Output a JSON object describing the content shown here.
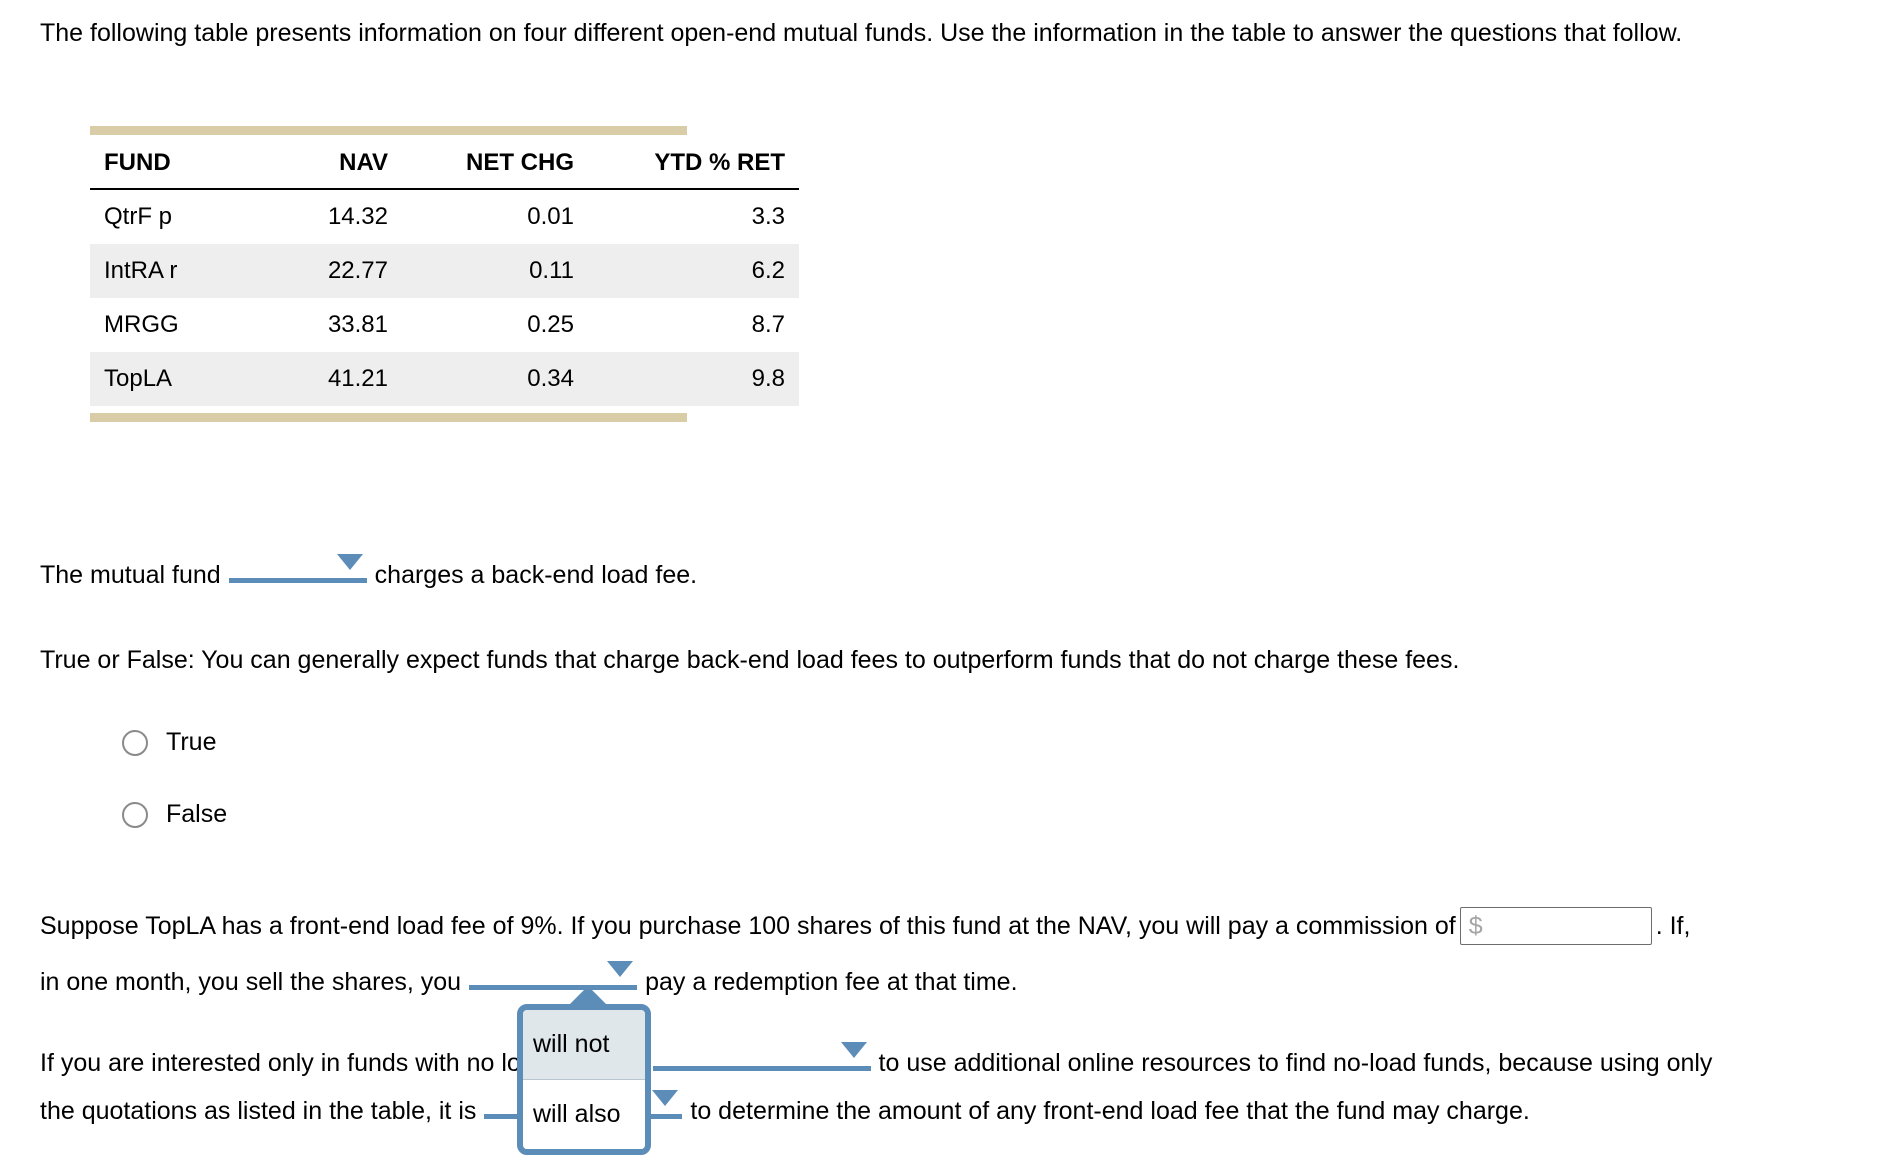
{
  "intro": "The following table presents information on four different open-end mutual funds. Use the information in the table to answer the questions that follow.",
  "table": {
    "headers": [
      "FUND",
      "NAV",
      "NET CHG",
      "YTD % RET"
    ],
    "rows": [
      {
        "fund": "QtrF p",
        "nav": "14.32",
        "net_chg": "0.01",
        "ytd_pct_ret": "3.3"
      },
      {
        "fund": "IntRA r",
        "nav": "22.77",
        "net_chg": "0.11",
        "ytd_pct_ret": "6.2"
      },
      {
        "fund": "MRGG",
        "nav": "33.81",
        "net_chg": "0.25",
        "ytd_pct_ret": "8.7"
      },
      {
        "fund": "TopLA",
        "nav": "41.21",
        "net_chg": "0.34",
        "ytd_pct_ret": "9.8"
      }
    ],
    "rule_color": "#d8cda6",
    "alt_row_color": "#eeeeee"
  },
  "question1": {
    "before": "The mutual fund",
    "dropdown_value": "",
    "after": "charges a back-end load fee."
  },
  "question2": {
    "prompt": "True or False: You can generally expect funds that charge back-end load fees to outperform funds that do not charge these fees.",
    "options": [
      {
        "label": "True",
        "selected": false
      },
      {
        "label": "False",
        "selected": false
      }
    ]
  },
  "question3": {
    "line1_before": "Suppose TopLA has a front-end load fee of 9%. If you purchase 100 shares of this fund at the NAV, you will pay a commission of",
    "money_value": "",
    "money_placeholder": "$",
    "line1_after": ". If,",
    "line2_before": "in one month, you sell the shares, you",
    "line2_dropdown_value": "",
    "line2_after": "pay a redemption fee at that time."
  },
  "question4": {
    "line1_before": "If you are interested only in funds with no load fee, you",
    "line1_dropdown_value": "",
    "line1_after": "to use additional online resources to find no-load funds, because using only",
    "line2_before": "the quotations as listed in the table, it is",
    "line2_dropdown_value": "",
    "line2_after": "to determine the amount of any front-end load fee that the fund may charge."
  },
  "popup": {
    "items": [
      {
        "label": "will not",
        "selected": true
      },
      {
        "label": "will also",
        "selected": false
      }
    ],
    "border_color": "#5b8db8",
    "selected_bg": "#dfe7eb"
  },
  "colors": {
    "accent_blue": "#5b8db8",
    "table_rule_tan": "#d8cda6",
    "placeholder_gray": "#a5a5a5",
    "radio_border_gray": "#8a8a8a"
  }
}
